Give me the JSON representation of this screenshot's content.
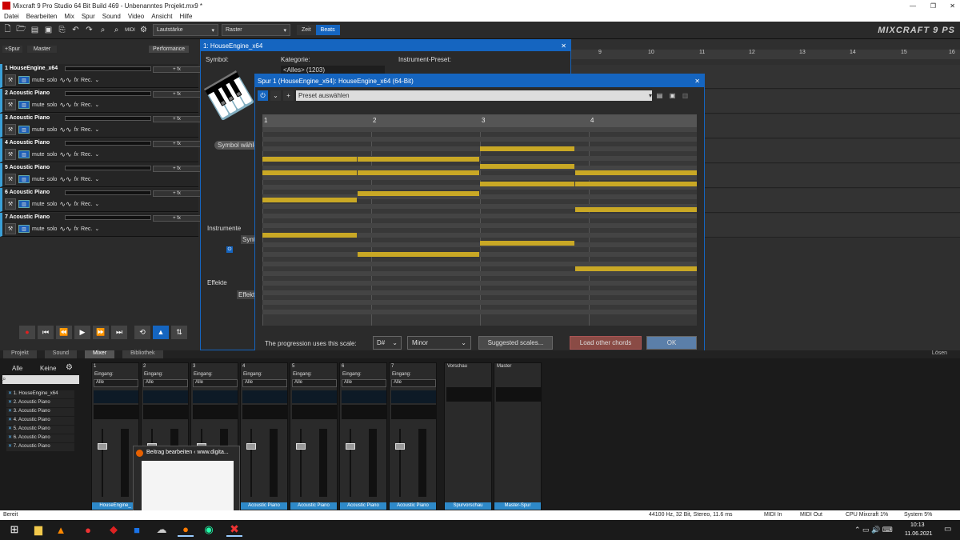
{
  "window": {
    "title": "Mixcraft 9 Pro Studio 64 Bit Build 469 - Unbenanntes Projekt.mx9 *"
  },
  "menu": [
    "Datei",
    "Bearbeiten",
    "Mix",
    "Spur",
    "Sound",
    "Video",
    "Ansicht",
    "Hilfe"
  ],
  "toolbar": {
    "volume": "Lautstärke",
    "grid": "Raster",
    "time": "Zeit",
    "beats": "Beats",
    "logo": "MIXCRAFT 9 PS"
  },
  "tracks_header": {
    "add": "+Spur",
    "master": "Master",
    "performance": "Performance"
  },
  "tracks": [
    {
      "name": "1 HouseEngine_x64"
    },
    {
      "name": "2 Acoustic Piano"
    },
    {
      "name": "3 Acoustic Piano"
    },
    {
      "name": "4 Acoustic Piano"
    },
    {
      "name": "5 Acoustic Piano"
    },
    {
      "name": "6 Acoustic Piano"
    },
    {
      "name": "7 Acoustic Piano"
    }
  ],
  "track_labels": {
    "mute": "mute",
    "solo": "solo",
    "fx": "fx",
    "rec": "Rec.",
    "addfx": "+ fx"
  },
  "ruler": [
    "9",
    "10",
    "11",
    "12",
    "13",
    "14",
    "15",
    "16"
  ],
  "dialog1": {
    "title": "1: HouseEngine_x64",
    "symbol": "Symbol:",
    "category": "Kategorie:",
    "category_value": "<Alles> (1203)",
    "preset": "Instrument-Preset:",
    "symbol_btn": "Symbol wähle",
    "instruments": "Instrumente",
    "synth": "Synth",
    "effects": "Effekte",
    "effect": "Effekt"
  },
  "dialog2": {
    "title": "Spur 1 (HouseEngine_x64): HouseEngine_x64 (64-Bit)",
    "preset": "Preset auswählen",
    "bars": [
      "1",
      "2",
      "3",
      "4"
    ],
    "scale_label": "The progression uses this scale:",
    "key": "D#",
    "mode": "Minor",
    "suggest": "Suggested scales...",
    "load": "Load other chords",
    "ok": "OK"
  },
  "tabs": [
    "Projekt",
    "Sound",
    "Mixer",
    "Bibliothek"
  ],
  "mixer": {
    "all": "Alle",
    "none": "Keine",
    "detach": "Lösen",
    "input": "Eingang:",
    "input_val": "Alle",
    "preview": "Vorschau",
    "master": "Master",
    "list": [
      "1. HouseEngine_x64",
      "2. Acoustic Piano",
      "3. Acoustic Piano",
      "4. Acoustic Piano",
      "5. Acoustic Piano",
      "6. Acoustic Piano",
      "7. Acoustic Piano"
    ],
    "channels": [
      "HouseEngine_",
      "Acoustic Piano",
      "Acoustic Piano",
      "Acoustic Piano",
      "Acoustic Piano",
      "Acoustic Piano",
      "Acoustic Piano"
    ],
    "ch_nums": [
      "1",
      "2",
      "3",
      "4",
      "5",
      "6",
      "7"
    ],
    "preview_name": "Spurvorschau",
    "master_name": "Master-Spur"
  },
  "status": {
    "ready": "Bereit",
    "audio": "44100 Hz, 32 Bit, Stereo, 11.6 ms",
    "midi_in": "MIDI In",
    "midi_out": "MIDI Out",
    "cpu": "CPU Mixcraft 1%",
    "system": "System 5%"
  },
  "popup": {
    "title": "Beitrag bearbeiten ‹ www.digita..."
  },
  "clock": {
    "time": "10:13",
    "date": "11.06.2021"
  }
}
